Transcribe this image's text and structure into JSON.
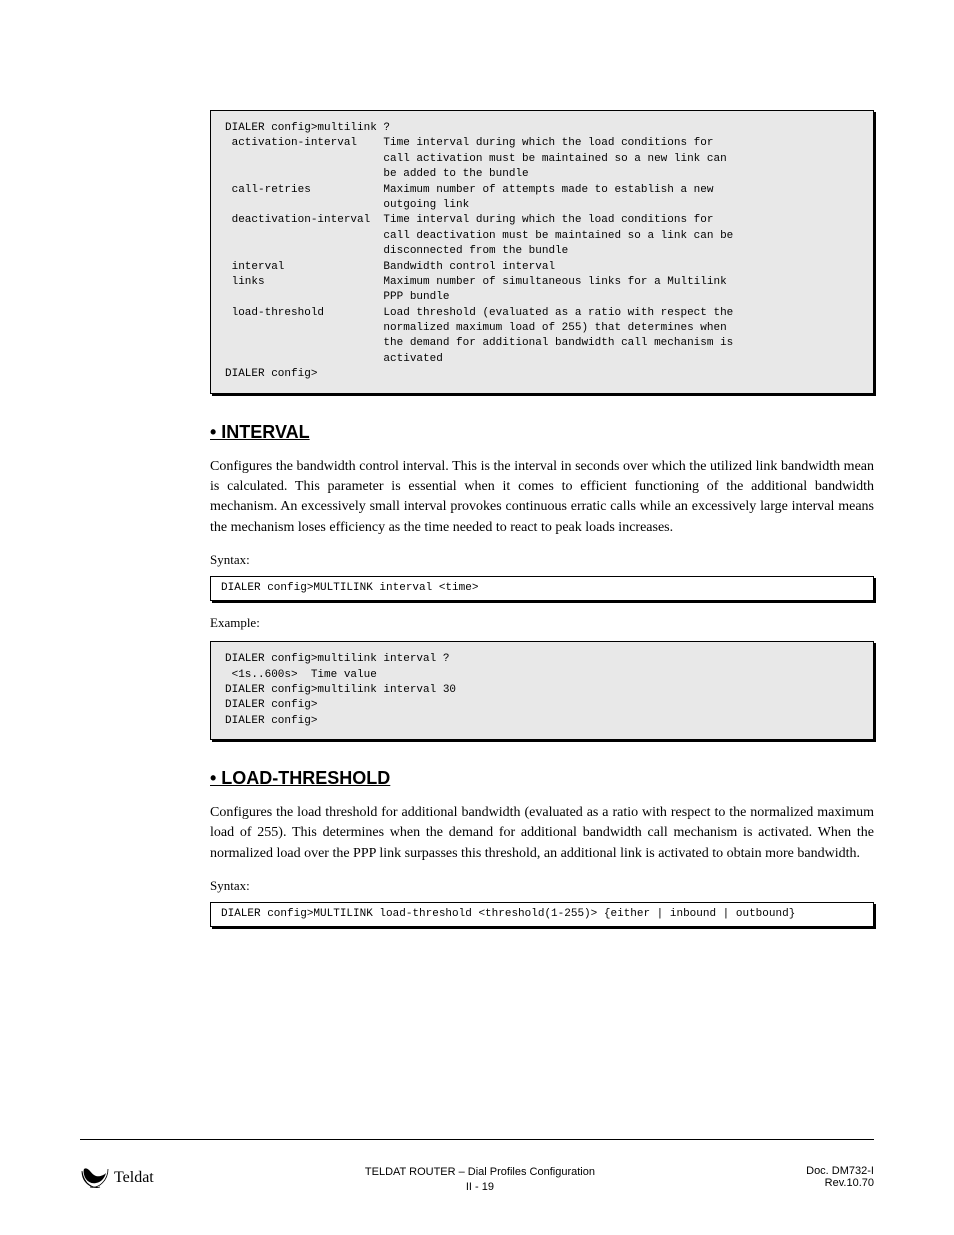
{
  "code_block_1": "DIALER config>multilink ?\n activation-interval    Time interval during which the load conditions for\n                        call activation must be maintained so a new link can\n                        be added to the bundle\n call-retries           Maximum number of attempts made to establish a new\n                        outgoing link\n deactivation-interval  Time interval during which the load conditions for\n                        call deactivation must be maintained so a link can be\n                        disconnected from the bundle\n interval               Bandwidth control interval\n links                  Maximum number of simultaneous links for a Multilink\n                        PPP bundle\n load-threshold         Load threshold (evaluated as a ratio with respect the\n                        normalized maximum load of 255) that determines when\n                        the demand for additional bandwidth call mechanism is\n                        activated\nDIALER config>",
  "section_1": {
    "heading": "• INTERVAL",
    "para": "Configures the bandwidth control interval. This is the interval in seconds over which the utilized link bandwidth mean is calculated. This parameter is essential when it comes to efficient functioning of the additional bandwidth mechanism. An excessively small interval provokes continuous erratic calls while an excessively large interval means the mechanism loses efficiency as the time needed to react to peak loads increases."
  },
  "syntax_label": "Syntax:",
  "code_syntax_1": "DIALER config>MULTILINK interval <time>",
  "example_label": "Example:",
  "code_example_1": "DIALER config>multilink interval ?\n <1s..600s>  Time value\nDIALER config>multilink interval 30\nDIALER config>\nDIALER config>",
  "section_2": {
    "heading": "• LOAD-THRESHOLD",
    "para": "Configures the load threshold for additional bandwidth (evaluated as a ratio with respect to the normalized maximum load of 255). This determines when the demand for additional bandwidth call mechanism is activated. When the normalized load over the PPP link surpasses this threshold, an additional link is activated to obtain more bandwidth."
  },
  "code_syntax_2": "DIALER config>MULTILINK load-threshold <threshold(1-255)> {either | inbound | outbound}",
  "footer": {
    "brand": "Teldat",
    "center_line1": "TELDAT ROUTER – Dial Profiles Configuration",
    "center_line2": "II - 19",
    "right_line1": "Doc. DM732-I",
    "right_line2": "Rev.10.70"
  }
}
